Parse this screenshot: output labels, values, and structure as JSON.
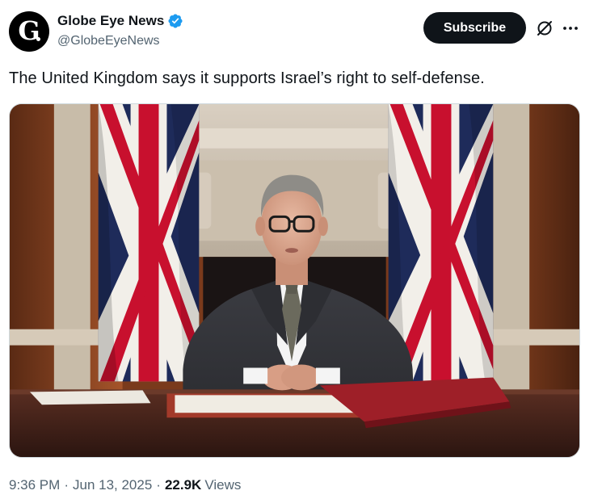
{
  "author": {
    "display_name": "Globe Eye News",
    "handle": "@GlobeEyeNews",
    "avatar_letter": "G",
    "verified": true,
    "verified_color": "#1d9bf0"
  },
  "actions": {
    "subscribe_label": "Subscribe",
    "grok_icon": "grok-slash-circle-icon",
    "more_icon": "more-dots-icon"
  },
  "tweet": {
    "text": "The United Kingdom says it supports Israel’s right to self-defense."
  },
  "media": {
    "type": "photo",
    "icon": "photo"
  },
  "footer": {
    "time": "9:36 PM",
    "date": "Jun 13, 2025",
    "separator": "·",
    "views_count": "22.9K",
    "views_label": "Views"
  },
  "colors": {
    "text_primary": "#0f1419",
    "text_secondary": "#536471",
    "subscribe_bg": "#0f1419",
    "verified": "#1d9bf0"
  }
}
